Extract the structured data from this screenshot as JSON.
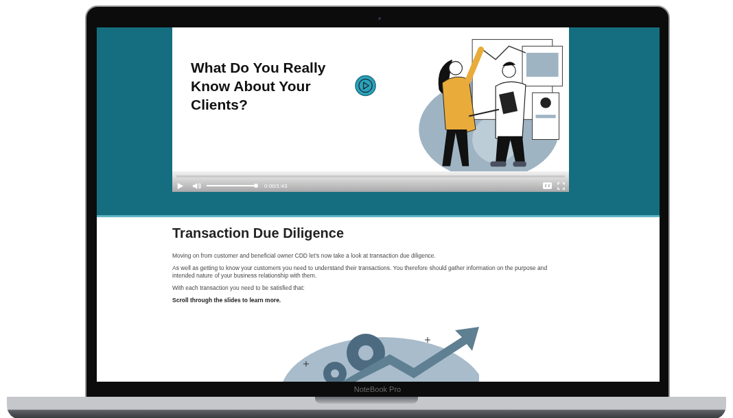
{
  "device": {
    "label": "NoteBook Pro"
  },
  "video": {
    "title": "What Do You Really Know About Your Clients?",
    "progress": {
      "level": 0
    },
    "volume": {
      "level": 1
    },
    "time": "0:00/1:43"
  },
  "section": {
    "heading": "Transaction Due Diligence",
    "paragraphs": [
      {
        "kind": "plain",
        "text": "Moving on from customer and beneficial owner CDD let’s now take a look at transaction due diligence."
      },
      {
        "kind": "plain",
        "text": "As well as getting to know your customers you need to understand their transactions. You therefore should gather information on the purpose and intended nature of your business relationship with them."
      },
      {
        "kind": "plain",
        "text": "With each transaction you need to be satisfied that:"
      },
      {
        "kind": "strong",
        "text": "Scroll through the slides to learn more."
      }
    ]
  }
}
